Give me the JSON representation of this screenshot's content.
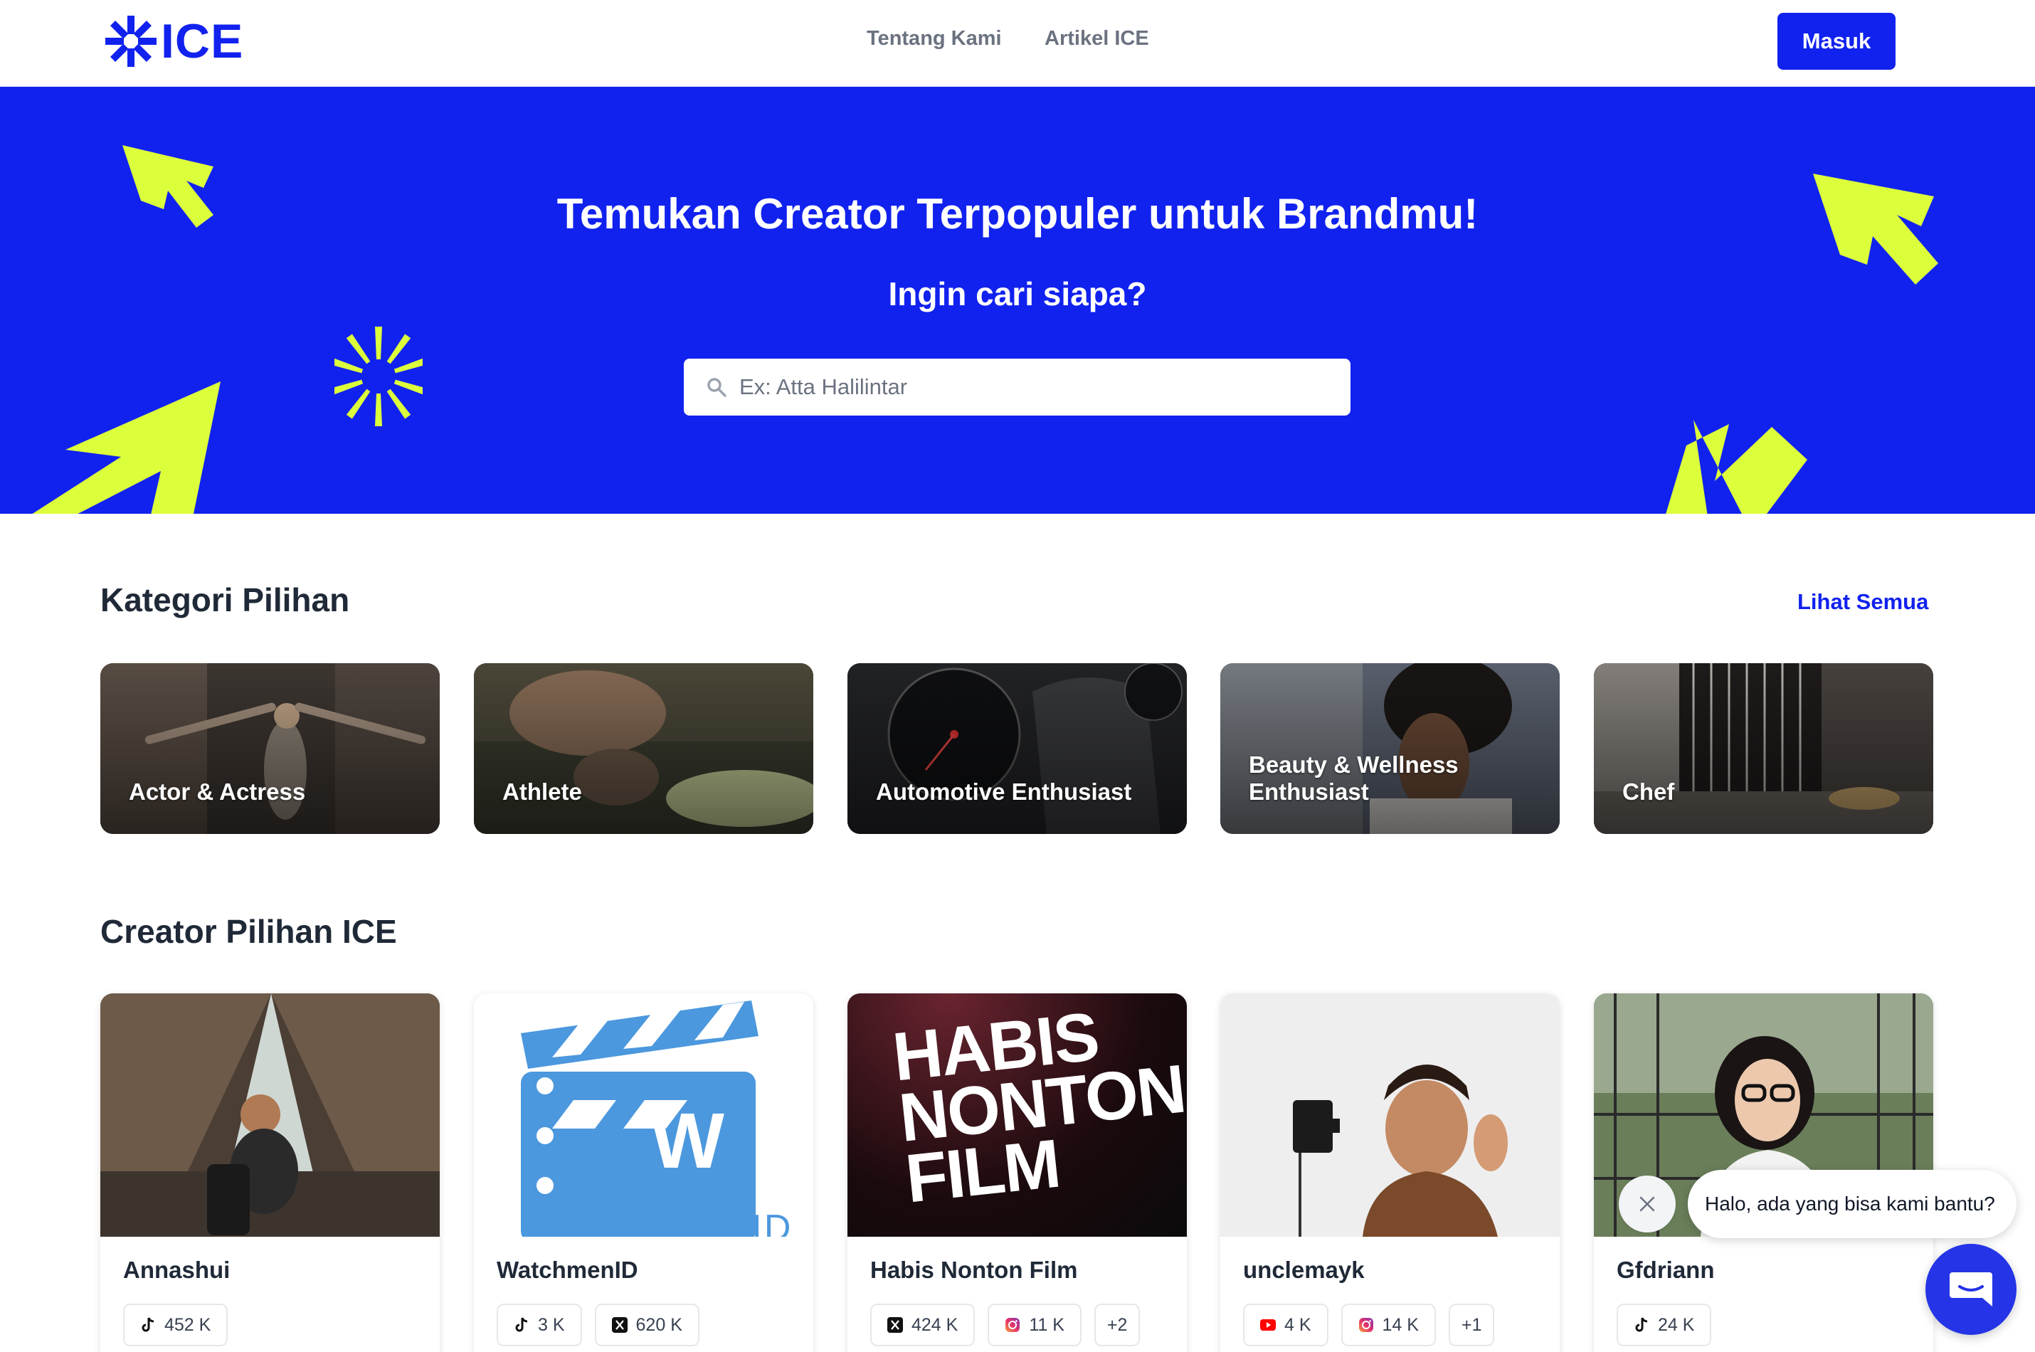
{
  "header": {
    "logo_text": "ICE",
    "nav": [
      {
        "label": "Tentang Kami"
      },
      {
        "label": "Artikel ICE"
      }
    ],
    "login_label": "Masuk"
  },
  "hero": {
    "title": "Temukan Creator Terpopuler untuk Brandmu!",
    "subtitle": "Ingin cari siapa?",
    "search_placeholder": "Ex: Atta Halilintar"
  },
  "categories": {
    "title": "Kategori Pilihan",
    "see_all": "Lihat Semua",
    "items": [
      {
        "label": "Actor & Actress"
      },
      {
        "label": "Athlete"
      },
      {
        "label": "Automotive Enthusiast"
      },
      {
        "label": "Beauty & Wellness Enthusiast"
      },
      {
        "label": "Chef"
      }
    ]
  },
  "creators": {
    "title": "Creator Pilihan ICE",
    "items": [
      {
        "name": "Annashui",
        "stats": [
          {
            "icon": "tiktok-icon",
            "value": "452 K"
          }
        ]
      },
      {
        "name": "WatchmenID",
        "image_text": "WATCHMENID",
        "stats": [
          {
            "icon": "tiktok-icon",
            "value": "3 K"
          },
          {
            "icon": "x-icon",
            "value": "620 K"
          }
        ]
      },
      {
        "name": "Habis Nonton Film",
        "image_text": [
          "HABIS",
          "NONTON",
          "FILM"
        ],
        "stats": [
          {
            "icon": "x-icon",
            "value": "424 K"
          },
          {
            "icon": "instagram-icon",
            "value": "11 K"
          },
          {
            "icon": "",
            "value": "+2"
          }
        ]
      },
      {
        "name": "unclemayk",
        "stats": [
          {
            "icon": "youtube-icon",
            "value": "4 K"
          },
          {
            "icon": "instagram-icon",
            "value": "14 K"
          },
          {
            "icon": "",
            "value": "+1"
          }
        ]
      },
      {
        "name": "Gfdriann",
        "stats": [
          {
            "icon": "tiktok-icon",
            "value": "24 K"
          }
        ]
      }
    ]
  },
  "chat": {
    "message": "Halo, ada yang bisa kami bantu?"
  },
  "colors": {
    "brand_blue": "#1122ee",
    "accent_lime": "#dcff3c"
  }
}
